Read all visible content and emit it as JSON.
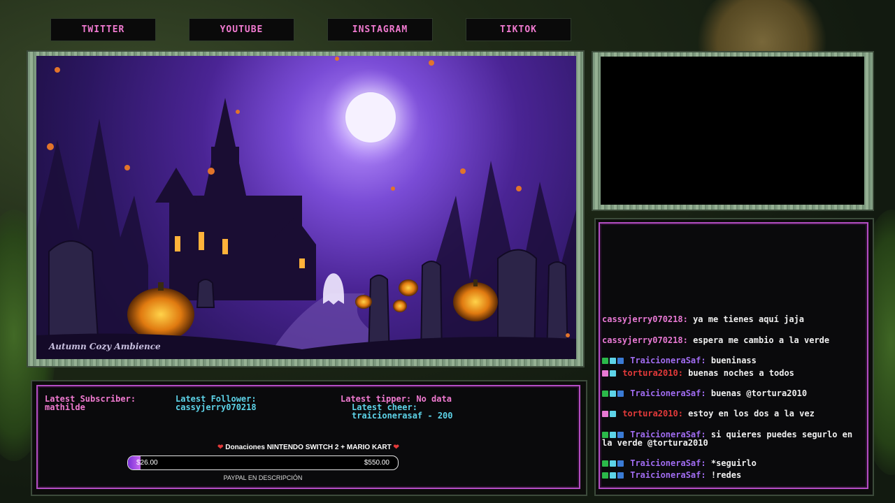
{
  "socials": [
    "TWITTER",
    "YOUTUBE",
    "INSTAGRAM",
    "TIKTOK"
  ],
  "video": {
    "watermark": "Autumn Cozy Ambience"
  },
  "stats": {
    "subscriber_label": "Latest Subscriber:",
    "subscriber_value": "mathilde",
    "follower_label": "Latest Follower:",
    "follower_value": "cassyjerry070218",
    "tipper": "Latest tipper: No data",
    "cheer_label": "Latest cheer:",
    "cheer_value": "traicionerasaf - 200"
  },
  "donation": {
    "title": "Donaciones NINTENDO SWITCH 2 + MARIO KART",
    "current": "$26.00",
    "goal": "$550.00",
    "progress": 0.047,
    "footer": "PAYPAL EN DESCRIPCIÓN"
  },
  "chat": [
    {
      "user": "cassyjerry070218:",
      "text": "ya me tienes aquí jaja",
      "badges": []
    },
    {
      "user": "cassyjerry070218:",
      "text": "espera me cambio a la verde",
      "badges": []
    },
    {
      "user": "TraicioneraSaf:",
      "text": "bueninass",
      "badges": [
        "mod",
        "crown",
        "sub"
      ]
    },
    {
      "user": "tortura2010:",
      "text": "buenas noches a todos",
      "badges": [
        "heart",
        "crown"
      ]
    },
    {
      "user": "TraicioneraSaf:",
      "text": "buenas @tortura2010",
      "badges": [
        "mod",
        "crown",
        "sub"
      ]
    },
    {
      "user": "tortura2010:",
      "text": "estoy en los dos a la vez",
      "badges": [
        "heart",
        "crown"
      ]
    },
    {
      "user": "TraicioneraSaf:",
      "text": "si quieres puedes segurlo en la verde @tortura2010",
      "badges": [
        "mod",
        "crown",
        "sub"
      ]
    },
    {
      "user": "TraicioneraSaf:",
      "text": "*seguirlo",
      "badges": [
        "mod",
        "crown",
        "sub"
      ]
    },
    {
      "user": "TraicioneraSaf:",
      "text": "!redes",
      "badges": [
        "mod",
        "crown",
        "sub"
      ]
    }
  ],
  "colors": {
    "accent_pink": "#f07ad0",
    "cyan": "#5dd3e8",
    "frame_green": "#8aa58a",
    "panel_border": "#b44ec4"
  }
}
